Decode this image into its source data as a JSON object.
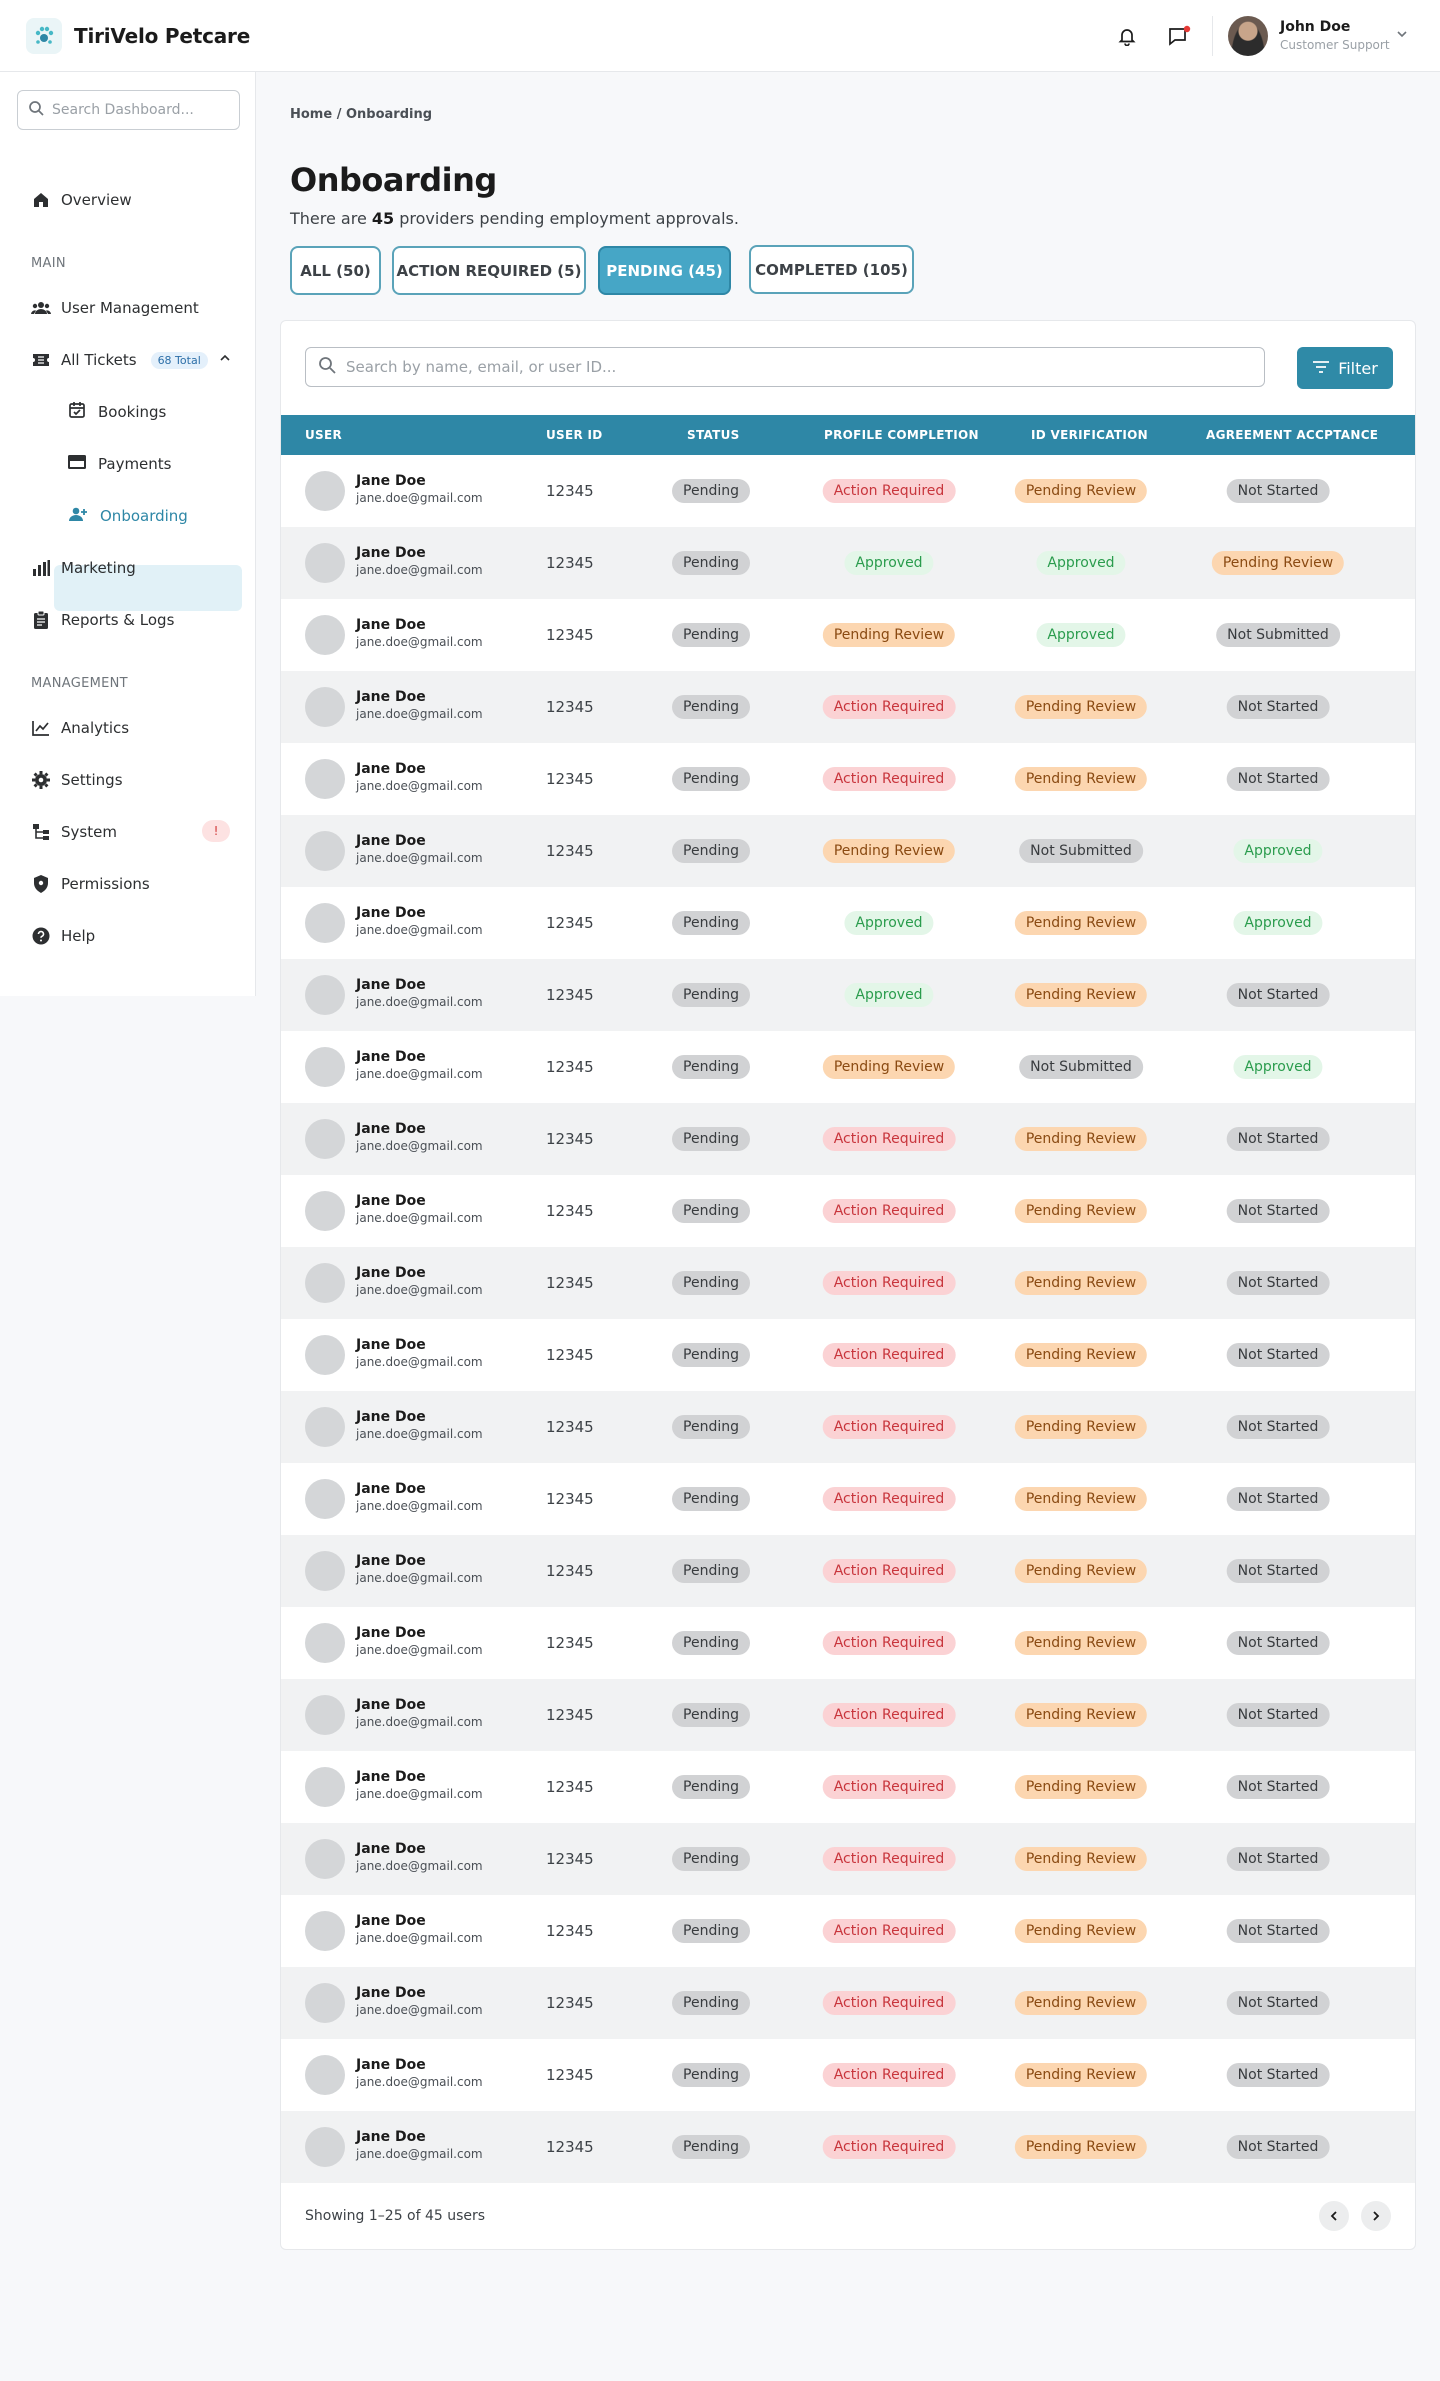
{
  "brand": {
    "name": "TiriVelo Petcare"
  },
  "header": {
    "user_name": "John Doe",
    "user_role": "Customer Support"
  },
  "sidebar": {
    "search_placeholder": "Search Dashboard...",
    "overview": "Overview",
    "main_label": "MAIN",
    "user_management": "User Management",
    "all_tickets": "All Tickets",
    "tickets_badge": "68 Total",
    "bookings": "Bookings",
    "payments": "Payments",
    "onboarding": "Onboarding",
    "marketing": "Marketing",
    "reports": "Reports & Logs",
    "management_label": "MANAGEMENT",
    "analytics": "Analytics",
    "settings": "Settings",
    "system": "System",
    "system_badge": "!",
    "permissions": "Permissions",
    "help": "Help"
  },
  "breadcrumb": "Home / Onboarding",
  "page": {
    "title": "Onboarding",
    "subtitle_pre": "There are ",
    "subtitle_count": "45",
    "subtitle_post": " providers pending employment approvals."
  },
  "tabs": [
    "ALL (50)",
    "ACTION REQUIRED (5)",
    "PENDING (45)",
    "COMPLETED (105)"
  ],
  "table": {
    "search_placeholder": "Search by name, email, or user ID...",
    "filter_label": "Filter",
    "columns": [
      "USER",
      "USER ID",
      "STATUS",
      "PROFILE COMPLETION",
      "ID VERIFICATION",
      "AGREEMENT ACCPTANCE"
    ],
    "rows": [
      [
        "Jane Doe",
        "jane.doe@gmail.com",
        "12345",
        "Pending",
        "Action Required",
        "Pending Review",
        "Not Started"
      ],
      [
        "Jane Doe",
        "jane.doe@gmail.com",
        "12345",
        "Pending",
        "Approved",
        "Approved",
        "Pending Review"
      ],
      [
        "Jane Doe",
        "jane.doe@gmail.com",
        "12345",
        "Pending",
        "Pending Review",
        "Approved",
        "Not Submitted"
      ],
      [
        "Jane Doe",
        "jane.doe@gmail.com",
        "12345",
        "Pending",
        "Action Required",
        "Pending Review",
        "Not Started"
      ],
      [
        "Jane Doe",
        "jane.doe@gmail.com",
        "12345",
        "Pending",
        "Action Required",
        "Pending Review",
        "Not Started"
      ],
      [
        "Jane Doe",
        "jane.doe@gmail.com",
        "12345",
        "Pending",
        "Pending Review",
        "Not Submitted",
        "Approved"
      ],
      [
        "Jane Doe",
        "jane.doe@gmail.com",
        "12345",
        "Pending",
        "Approved",
        "Pending Review",
        "Approved"
      ],
      [
        "Jane Doe",
        "jane.doe@gmail.com",
        "12345",
        "Pending",
        "Approved",
        "Pending Review",
        "Not Started"
      ],
      [
        "Jane Doe",
        "jane.doe@gmail.com",
        "12345",
        "Pending",
        "Pending Review",
        "Not Submitted",
        "Approved"
      ],
      [
        "Jane Doe",
        "jane.doe@gmail.com",
        "12345",
        "Pending",
        "Action Required",
        "Pending Review",
        "Not Started"
      ],
      [
        "Jane Doe",
        "jane.doe@gmail.com",
        "12345",
        "Pending",
        "Action Required",
        "Pending Review",
        "Not Started"
      ],
      [
        "Jane Doe",
        "jane.doe@gmail.com",
        "12345",
        "Pending",
        "Action Required",
        "Pending Review",
        "Not Started"
      ],
      [
        "Jane Doe",
        "jane.doe@gmail.com",
        "12345",
        "Pending",
        "Action Required",
        "Pending Review",
        "Not Started"
      ],
      [
        "Jane Doe",
        "jane.doe@gmail.com",
        "12345",
        "Pending",
        "Action Required",
        "Pending Review",
        "Not Started"
      ],
      [
        "Jane Doe",
        "jane.doe@gmail.com",
        "12345",
        "Pending",
        "Action Required",
        "Pending Review",
        "Not Started"
      ],
      [
        "Jane Doe",
        "jane.doe@gmail.com",
        "12345",
        "Pending",
        "Action Required",
        "Pending Review",
        "Not Started"
      ],
      [
        "Jane Doe",
        "jane.doe@gmail.com",
        "12345",
        "Pending",
        "Action Required",
        "Pending Review",
        "Not Started"
      ],
      [
        "Jane Doe",
        "jane.doe@gmail.com",
        "12345",
        "Pending",
        "Action Required",
        "Pending Review",
        "Not Started"
      ],
      [
        "Jane Doe",
        "jane.doe@gmail.com",
        "12345",
        "Pending",
        "Action Required",
        "Pending Review",
        "Not Started"
      ],
      [
        "Jane Doe",
        "jane.doe@gmail.com",
        "12345",
        "Pending",
        "Action Required",
        "Pending Review",
        "Not Started"
      ],
      [
        "Jane Doe",
        "jane.doe@gmail.com",
        "12345",
        "Pending",
        "Action Required",
        "Pending Review",
        "Not Started"
      ],
      [
        "Jane Doe",
        "jane.doe@gmail.com",
        "12345",
        "Pending",
        "Action Required",
        "Pending Review",
        "Not Started"
      ],
      [
        "Jane Doe",
        "jane.doe@gmail.com",
        "12345",
        "Pending",
        "Action Required",
        "Pending Review",
        "Not Started"
      ],
      [
        "Jane Doe",
        "jane.doe@gmail.com",
        "12345",
        "Pending",
        "Action Required",
        "Pending Review",
        "Not Started"
      ]
    ],
    "footer": "Showing 1–25 of 45 users"
  },
  "colors": {
    "accent": "#2e87a6",
    "active_tab": "#46a6c6",
    "pill_grey": "#d1d2d4",
    "pill_red": "#fbd2d4",
    "pill_orange": "#fcd6b0",
    "pill_green": "#e3f6e8"
  }
}
